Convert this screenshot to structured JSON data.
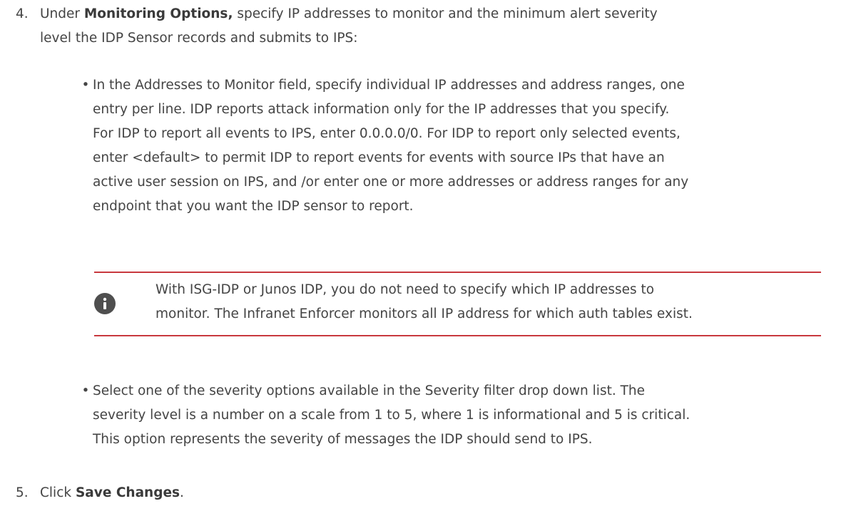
{
  "step4": {
    "number": "4.",
    "prefix": "Under ",
    "bold": "Monitoring Options,",
    "line1_rest": " specify IP addresses to monitor and the minimum alert severity",
    "line2": "level the IDP Sensor records and submits to IPS:"
  },
  "bullet1": {
    "dot": "•",
    "lines": [
      "In the Addresses to Monitor field, specify individual IP addresses and address ranges, one",
      "entry per line. IDP reports attack information only for the IP addresses that you specify.",
      "For IDP to report all events to IPS, enter 0.0.0.0/0. For IDP to report only selected events,",
      "enter <default> to permit IDP to report events for events with source IPs that have an",
      "active user session on IPS, and /or enter one or more addresses or address ranges for any",
      "endpoint that you want the IDP sensor to report."
    ]
  },
  "note": {
    "icon": "info-icon",
    "lines": [
      "With ISG-IDP or Junos IDP, you do not need to specify which IP addresses to",
      "monitor. The Infranet Enforcer monitors all IP address for which auth tables exist."
    ],
    "border_color": "#c8383e"
  },
  "bullet2": {
    "dot": "•",
    "lines": [
      "Select one of the severity options available in the Severity filter drop down list. The",
      "severity level is a number on a scale from 1 to 5, where 1 is informational and 5 is critical.",
      "This option represents the severity of messages the IDP should send to IPS."
    ]
  },
  "step5": {
    "number": "5.",
    "prefix": "Click ",
    "bold": "Save Changes",
    "suffix": "."
  }
}
